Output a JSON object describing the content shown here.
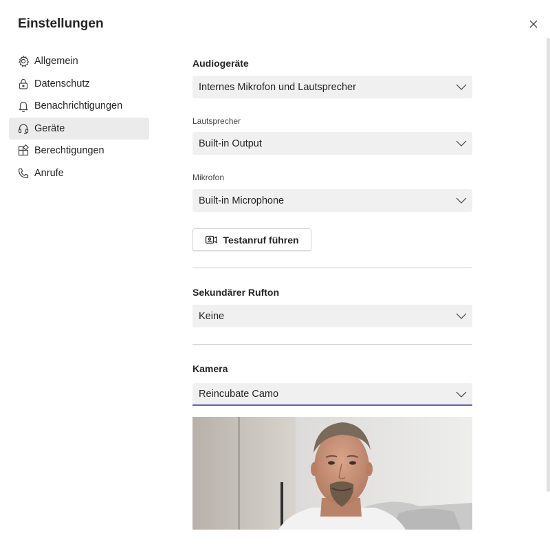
{
  "window": {
    "title": "Einstellungen"
  },
  "nav": {
    "items": [
      {
        "label": "Allgemein",
        "icon": "gear-icon"
      },
      {
        "label": "Datenschutz",
        "icon": "lock-icon"
      },
      {
        "label": "Benachrichtigungen",
        "icon": "bell-icon"
      },
      {
        "label": "Geräte",
        "icon": "headset-icon",
        "active": true
      },
      {
        "label": "Berechtigungen",
        "icon": "apps-icon"
      },
      {
        "label": "Anrufe",
        "icon": "phone-icon"
      }
    ]
  },
  "audio": {
    "title": "Audiogeräte",
    "device": "Internes Mikrofon und Lautsprecher",
    "speaker_label": "Lautsprecher",
    "speaker": "Built-in Output",
    "mic_label": "Mikrofon",
    "mic": "Built-in Microphone",
    "test_call_label": "Testanruf führen"
  },
  "ringtone": {
    "title": "Sekundärer Rufton",
    "value": "Keine"
  },
  "camera": {
    "title": "Kamera",
    "value": "Reincubate Camo"
  },
  "colors": {
    "accent": "#6264a7",
    "dropdown_bg": "#f0f0f0",
    "active_nav_bg": "#ebebeb"
  }
}
